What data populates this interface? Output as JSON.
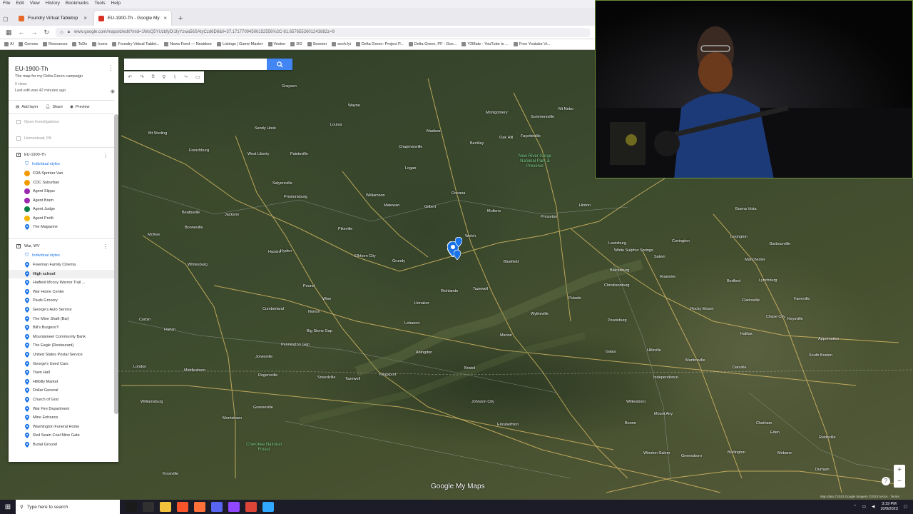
{
  "browser": {
    "menu": [
      "File",
      "Edit",
      "View",
      "History",
      "Bookmarks",
      "Tools",
      "Help"
    ],
    "tabs": [
      {
        "label": "Foundry Virtual Tabletop",
        "color": "#e8682a"
      },
      {
        "label": "EU-1900-Th - Google My Maps",
        "color": "#d93025"
      }
    ],
    "new_tab": "+",
    "url": "www.google.com/maps/d/edit?mid=1WsQ5YUzbfyDi1fyYzwa56SAtyCzd6D8&ll=37.17177094506152556%2C-81.6576552601243882z=9",
    "bookmarks": [
      "AI",
      "Comms",
      "Resources",
      "ToDo",
      "Icons",
      "Foundry Virtual Tablet...",
      "News Feed — Nextdoor",
      "Listings | Game Master",
      "Vesten",
      "DG",
      "Session",
      "sesh.fyi",
      "Delta Green: Project P...",
      "Delta Green, PF - Goo...",
      "Y2Mate - YouTube to ...",
      "Free Youtube Vi..."
    ]
  },
  "map_search": {
    "placeholder": "",
    "button": "search-icon"
  },
  "panel": {
    "title": "EU-1900-Th",
    "description": "The map for my Delta Green campaign",
    "views": "9 views",
    "last_edit": "Last edit was 42 minutes ago",
    "actions": {
      "add_layer": "Add layer",
      "share": "Share",
      "preview": "Preview"
    },
    "base_items": [
      "Open Investigations",
      "Homestead, PA"
    ],
    "layer1": {
      "name": "EU-1900-Th",
      "style": "Individual styles",
      "items": [
        {
          "label": "FDA Sprinter Van",
          "color": "#f29900"
        },
        {
          "label": "CDC Suburban",
          "color": "#f29900"
        },
        {
          "label": "Agent Slipps",
          "color": "#9c27b0"
        },
        {
          "label": "Agent Bram",
          "color": "#9c27b0"
        },
        {
          "label": "Agent Judge",
          "color": "#0b8043"
        },
        {
          "label": "Agent Profit",
          "color": "#f4b400"
        },
        {
          "label": "The Magazine",
          "color": "#1a73e8"
        }
      ]
    },
    "layer2": {
      "name": "War, WV",
      "style": "Individual styles",
      "items": [
        "Freeman Family Cinema",
        "High school",
        "Hatfield Mccoy Warrior Trail ...",
        "War Home Center",
        "Pauls Grocery",
        "George's Auto Service",
        "The Mine Shaft (Bar)",
        "Bill's Burgers!!!",
        "Mountaineer Community Bank",
        "The Eagle (Restaurant)",
        "United States Postal Service",
        "George's Used Cars",
        "Town Hall",
        "Hillbilly Market",
        "Dollar General",
        "Church of God",
        "War Fire Department",
        "Mine Entrance",
        "Washington Funeral Home",
        "Red Seam Coal Mine Gate",
        "Burial Ground"
      ],
      "selected": "High school"
    }
  },
  "map": {
    "towns": [
      {
        "t": "Grayson"
      },
      {
        "t": "Wayne"
      },
      {
        "t": "Sandy Hook"
      },
      {
        "t": "Mt Sterling"
      },
      {
        "t": "Frenchburg"
      },
      {
        "t": "West Liberty"
      },
      {
        "t": "Paintsville"
      },
      {
        "t": "Louisa"
      },
      {
        "t": "Chapmanville"
      },
      {
        "t": "Logan"
      },
      {
        "t": "Madison"
      },
      {
        "t": "Beckley"
      },
      {
        "t": "Oak Hill"
      },
      {
        "t": "Fayetteville"
      },
      {
        "t": "Montgomery"
      },
      {
        "t": "Mt Nebo"
      },
      {
        "t": "Summersville"
      },
      {
        "t": "Salyersville"
      },
      {
        "t": "Prestonsburg"
      },
      {
        "t": "Pikeville"
      },
      {
        "t": "Williamson"
      },
      {
        "t": "Matewan"
      },
      {
        "t": "Gilbert"
      },
      {
        "t": "Oceana"
      },
      {
        "t": "Mullens"
      },
      {
        "t": "Princeton"
      },
      {
        "t": "Bluefield"
      },
      {
        "t": "Welch"
      },
      {
        "t": "Grundy"
      },
      {
        "t": "Elkhorn City"
      },
      {
        "t": "Hazard"
      },
      {
        "t": "Jackson"
      },
      {
        "t": "Beattyville"
      },
      {
        "t": "Booneville"
      },
      {
        "t": "McKee"
      },
      {
        "t": "Hyden"
      },
      {
        "t": "Whitesburg"
      },
      {
        "t": "Pound"
      },
      {
        "t": "Wise"
      },
      {
        "t": "Norton"
      },
      {
        "t": "Big Stone Gap"
      },
      {
        "t": "Harlan"
      },
      {
        "t": "Middlesboro"
      },
      {
        "t": "Cumberland"
      },
      {
        "t": "Pennington Gap"
      },
      {
        "t": "Jonesville"
      },
      {
        "t": "Lebanon"
      },
      {
        "t": "Honaker"
      },
      {
        "t": "Tazewell"
      },
      {
        "t": "Richlands"
      },
      {
        "t": "Abingdon"
      },
      {
        "t": "Bristol"
      },
      {
        "t": "Kingsport"
      },
      {
        "t": "Johnson City"
      },
      {
        "t": "Elizabethton"
      },
      {
        "t": "Marion"
      },
      {
        "t": "Wytheville"
      },
      {
        "t": "Pulaski"
      },
      {
        "t": "Christiansburg"
      },
      {
        "t": "Blacksburg"
      },
      {
        "t": "Roanoke"
      },
      {
        "t": "Salem"
      },
      {
        "t": "Lynchburg"
      },
      {
        "t": "Bedford"
      },
      {
        "t": "Lexington"
      },
      {
        "t": "Buena Vista"
      },
      {
        "t": "Covington"
      },
      {
        "t": "Lewisburg"
      },
      {
        "t": "White Sulphur Springs"
      },
      {
        "t": "Hinton"
      },
      {
        "t": "Pearisburg"
      },
      {
        "t": "Rocky Mount"
      },
      {
        "t": "Martinsville"
      },
      {
        "t": "Danville"
      },
      {
        "t": "South Boston"
      },
      {
        "t": "Galax"
      },
      {
        "t": "Hillsville"
      },
      {
        "t": "Independence"
      },
      {
        "t": "Boone"
      },
      {
        "t": "Wilkesboro"
      },
      {
        "t": "Mount Airy"
      },
      {
        "t": "Winston-Salem"
      },
      {
        "t": "Greensboro"
      },
      {
        "t": "Burlington"
      },
      {
        "t": "Mebane"
      },
      {
        "t": "Durham"
      },
      {
        "t": "Knoxville"
      },
      {
        "t": "Morristown"
      },
      {
        "t": "Greeneville"
      },
      {
        "t": "Rogersville"
      },
      {
        "t": "Sneedville"
      },
      {
        "t": "Tazewell"
      },
      {
        "t": "London"
      },
      {
        "t": "Corbin"
      },
      {
        "t": "Williamsburg"
      },
      {
        "t": "Barbourville"
      },
      {
        "t": "Manchester"
      },
      {
        "t": "Farmville"
      },
      {
        "t": "Appomattox"
      },
      {
        "t": "Keysville"
      },
      {
        "t": "Chase City"
      },
      {
        "t": "Clarksville"
      },
      {
        "t": "Halifax"
      },
      {
        "t": "Chatham"
      },
      {
        "t": "Eden"
      },
      {
        "t": "Reidsville"
      },
      {
        "t": "Roxboro"
      },
      {
        "t": "Oxford"
      }
    ],
    "parks": [
      {
        "t": "New River Gorge National Park & Preserve"
      },
      {
        "t": "Cherokee National Forest"
      }
    ],
    "logo": "Google My Maps",
    "attribution": "Map data ©2023 Google Imagery ©2023 NASA · Terms"
  },
  "map_controls": {
    "zoom_in": "+",
    "zoom_out": "−",
    "help": "?"
  },
  "taskbar": {
    "search_placeholder": "Type here to search",
    "time": "3:19 PM",
    "date": "10/9/2023",
    "icons": [
      {
        "name": "cortana-icon",
        "color": "#1a1a1a"
      },
      {
        "name": "obs-icon",
        "color": "#303030"
      },
      {
        "name": "file-explorer-icon",
        "color": "#f3c33b"
      },
      {
        "name": "brave-icon",
        "color": "#fb542b"
      },
      {
        "name": "firefox-icon",
        "color": "#ff7139"
      },
      {
        "name": "discord-icon",
        "color": "#5865f2"
      },
      {
        "name": "twitch-icon",
        "color": "#9146ff"
      },
      {
        "name": "chrome-icon",
        "color": "#db4437"
      },
      {
        "name": "photoshop-icon",
        "color": "#31a8ff"
      }
    ]
  },
  "colors": {
    "accent": "#4285f4",
    "pin_blue": "#1a73e8",
    "link": "#1a73e8"
  }
}
